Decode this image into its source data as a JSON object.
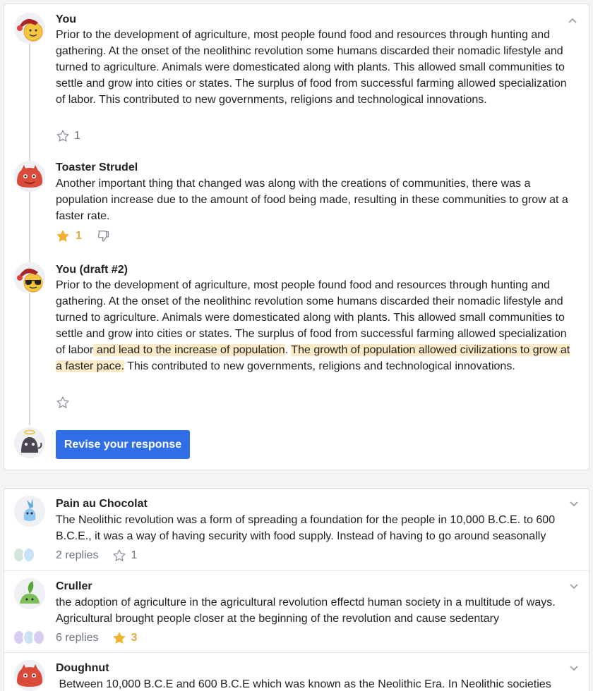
{
  "main_thread": {
    "posts": [
      {
        "author": "You",
        "avatar_icon": "smiley-santa-hat-icon",
        "text": "Prior to the development of agriculture, most people found food and resources through hunting and gathering. At the onset of the neolithinc revolution some humans discarded their nomadic lifestyle and turned to agriculture. Animals were domesticated along with plants. This allowed small communities to settle and grow into cities or states. The surplus of food from successful farming allowed specialization of labor. This contributed to new governments, religions and technological innovations.",
        "star_count": "1"
      },
      {
        "author": "Toaster Strudel",
        "avatar_icon": "red-monster-icon",
        "text": "Another important thing that changed was along with the creations of communities, there was a population increase due to the amount of food being made, resulting in these communities to grow at a faster rate.",
        "star_count": "1"
      },
      {
        "author": "You (draft #2)",
        "avatar_icon": "sunglasses-santa-hat-icon",
        "text_before": "Prior to the development of agriculture, most people found food and resources through hunting and gathering. At the onset of the neolithinc revolution some humans discarded their nomadic lifestyle and turned to agriculture. Animals were domesticated along with plants. This allowed small communities to settle and grow into cities or states. The surplus of food from successful farming allowed specialization of labor",
        "highlight_1": " and lead to the increase of population",
        "between": ". ",
        "highlight_2": "The growth of population allowed civilizations to grow at a faster pace.",
        "text_after": " This contributed to new governments, religions and technological innovations."
      }
    ],
    "reviser_avatar_icon": "halo-creature-icon",
    "revise_button": "Revise your response"
  },
  "responses": [
    {
      "author": "Pain au Chocolat",
      "avatar_icon": "blue-bird-icon",
      "text": "The Neolithic revolution was a form of spreading a foundation for the people in 10,000 B.C.E. to 600 B.C.E., it was a way of having security with food supply. Instead of having to go around seasonally",
      "replies": "2 replies",
      "star_count": "1",
      "star_filled": false
    },
    {
      "author": "Cruller",
      "avatar_icon": "green-leaf-creature-icon",
      "text": "the adoption of  agriculture in the agricultural revolution effectd human society in a multitude of ways. Agricultural brought people closer at the beginning of the revolution and cause sedentary",
      "replies": "6 replies",
      "star_count": "3",
      "star_filled": true
    },
    {
      "author": "Doughnut",
      "avatar_icon": "red-monster-icon",
      "text": " Between 10,000 B.C.E and 600 B.C.E which was known as the Neolithic Era. In Neolithic societies",
      "replies": "",
      "star_count": "",
      "star_filled": false
    }
  ],
  "colors": {
    "accent": "#2f6ee6",
    "highlight": "#fcebc6",
    "star_gold": "#f0b232"
  }
}
